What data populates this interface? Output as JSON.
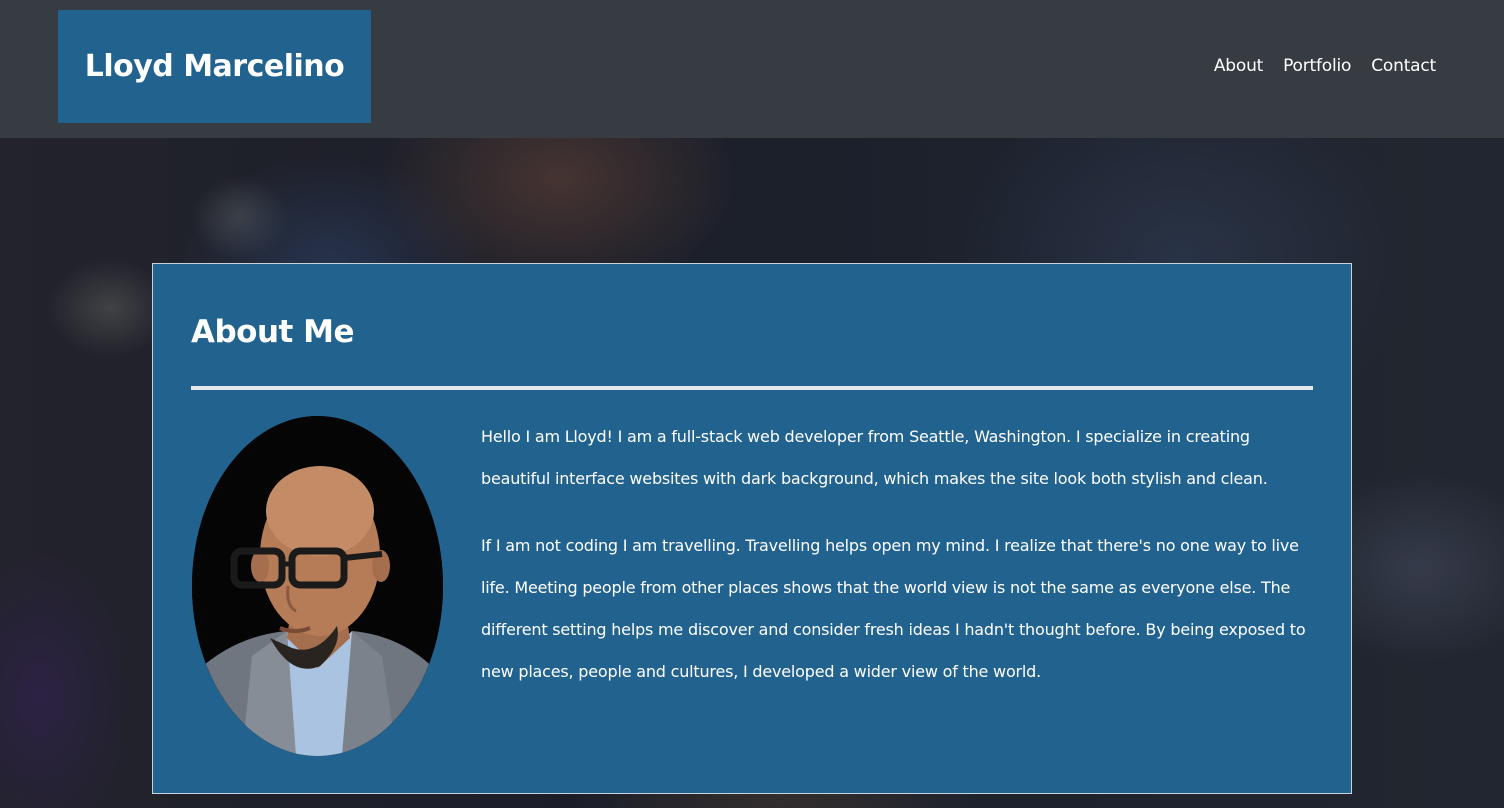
{
  "header": {
    "brand": "Lloyd Marcelino",
    "nav": [
      {
        "label": "About"
      },
      {
        "label": "Portfolio"
      },
      {
        "label": "Contact"
      }
    ]
  },
  "about": {
    "title": "About Me",
    "paragraphs": [
      "Hello I am Lloyd! I am a full-stack web developer from Seattle, Washington. I specialize in creating beautiful interface websites with dark background, which makes the site look both stylish and clean.",
      "If I am not coding I am travelling. Travelling helps open my mind. I realize that there's no one way to live life. Meeting people from other places shows that the world view is not the same as everyone else. The different setting helps me discover and consider fresh ideas I hadn't thought before. By being exposed to new places, people and cultures, I developed a wider view of the world."
    ]
  },
  "colors": {
    "header_bg": "#373b42",
    "accent": "#22628f",
    "text": "#ffffff"
  }
}
